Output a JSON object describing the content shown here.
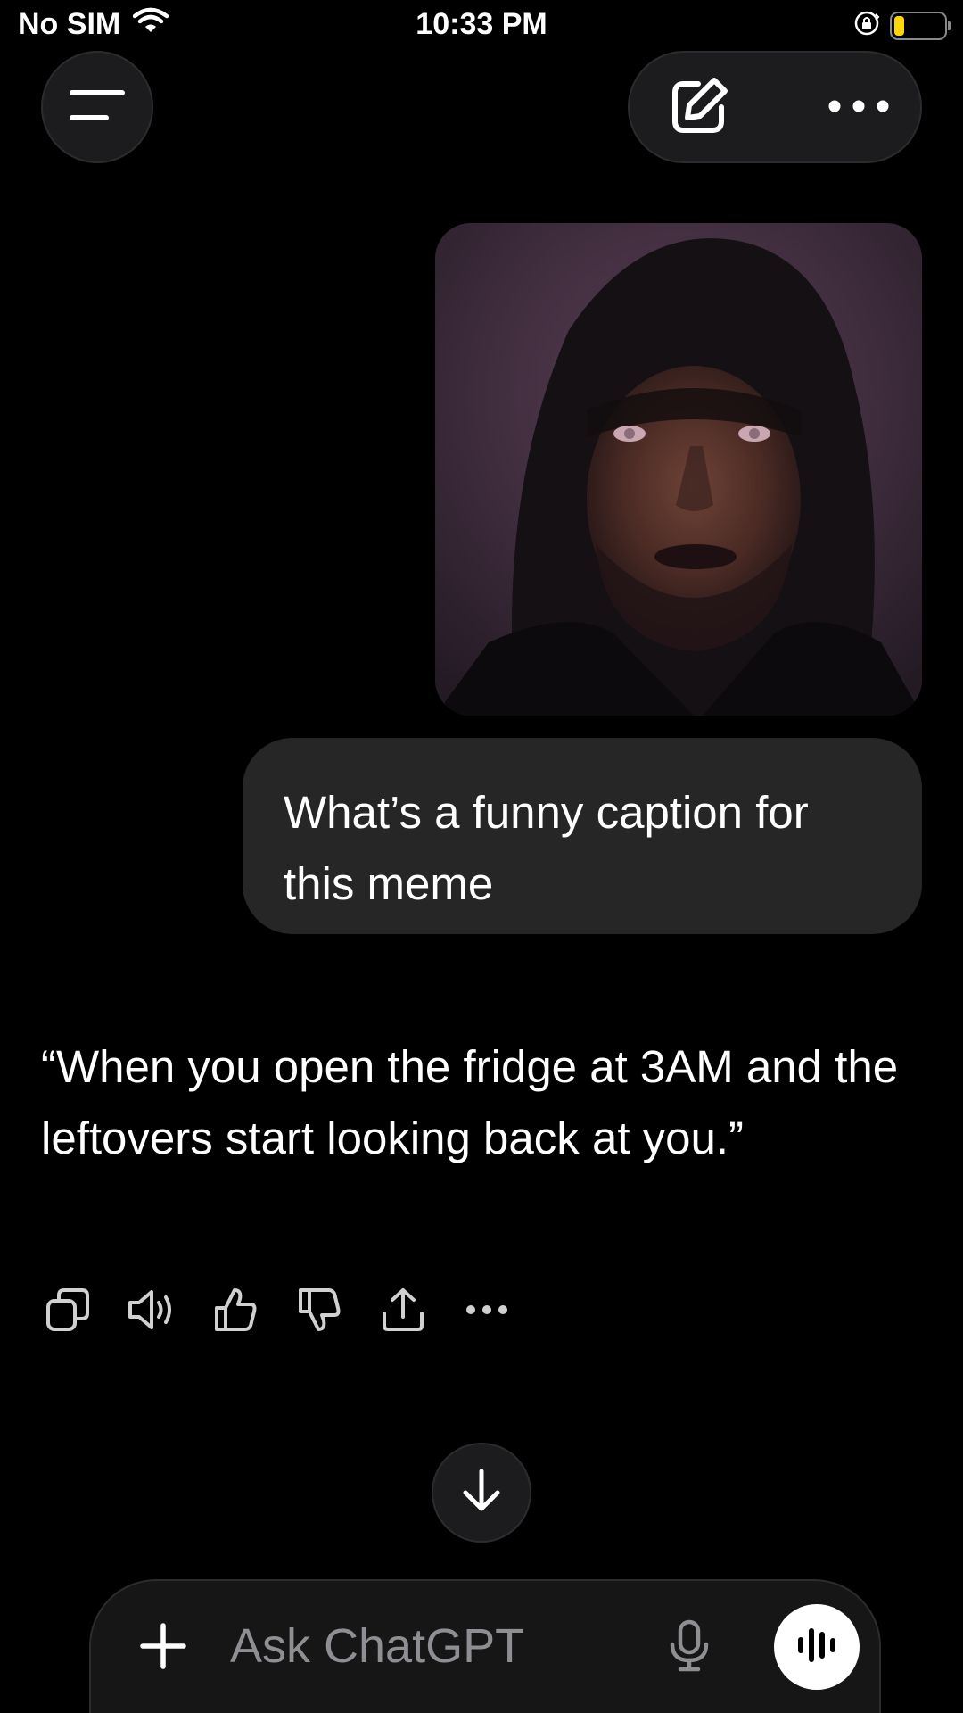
{
  "status_bar": {
    "carrier": "No SIM",
    "time": "10:33 PM",
    "battery_color": "#ffd60a"
  },
  "header": {
    "menu_icon": "hamburger-icon",
    "new_chat_icon": "edit-icon",
    "more_icon": "ellipsis-icon"
  },
  "conversation": {
    "user_message": "What’s a funny caption for this meme",
    "assistant_message": "“When you open the fridge at 3AM and the leftovers start looking back at you.”",
    "actions": [
      "copy-icon",
      "speaker-icon",
      "thumbs-up-icon",
      "thumbs-down-icon",
      "share-icon",
      "ellipsis-icon"
    ]
  },
  "composer": {
    "placeholder": "Ask ChatGPT",
    "value": ""
  },
  "colors": {
    "background": "#000000",
    "bubble": "#262626",
    "button_bg": "#1c1c1e"
  }
}
